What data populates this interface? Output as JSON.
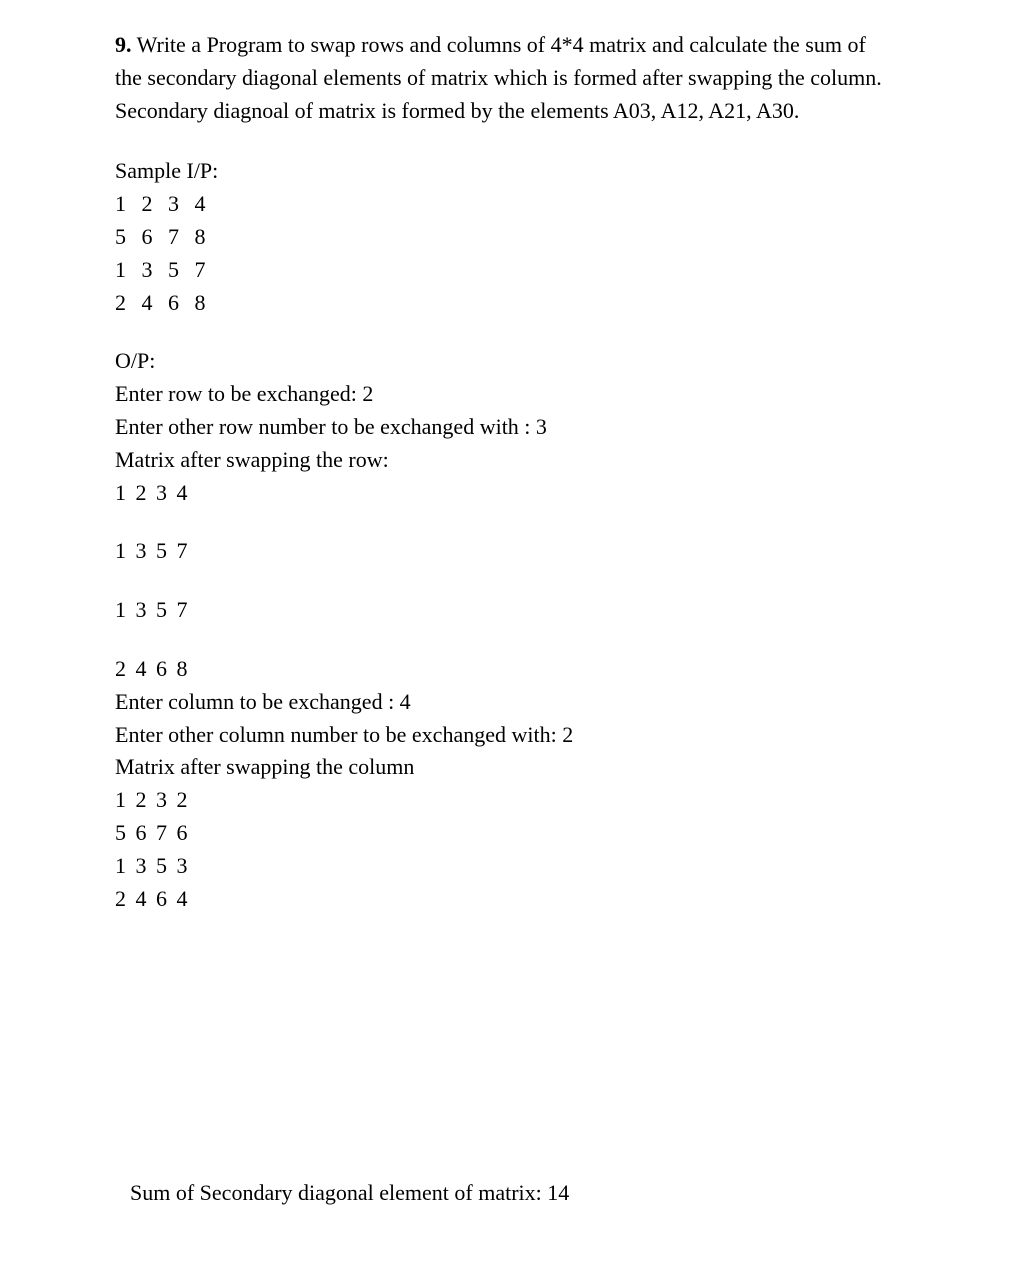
{
  "question": {
    "number": "9.",
    "text1": "Write a  Program to swap rows and columns of 4*4 matrix and calculate the sum of",
    "text2": "the secondary diagonal elements of matrix which is formed after swapping the  column.",
    "text3": "Secondary diagnoal of matrix is formed by the elements A03, A12, A21, A30."
  },
  "sample_ip": {
    "label": "Sample I/P:",
    "rows": [
      "1   2   3   4",
      "5   6   7   8",
      "1   3   5   7",
      "2   4   6   8"
    ]
  },
  "op": {
    "label": "O/P:",
    "row_prompt1": "Enter row to be exchanged: 2",
    "row_prompt2": "Enter other row number to be exchanged with : 3",
    "after_row_label": "Matrix after swapping the row:",
    "row_matrix": [
      "1 2 3 4",
      "1 3 5 7",
      "1 3 5 7",
      "2 4 6 8"
    ],
    "col_prompt1": "Enter column to be exchanged : 4",
    "col_prompt2": "Enter other column number to be exchanged with: 2",
    "after_col_label": "Matrix after swapping the column",
    "col_matrix": [
      "1 2 3 2",
      "5 6 7 6",
      "1 3 5 3",
      "2 4 6 4"
    ]
  },
  "sum": "Sum of Secondary diagonal element of matrix: 14"
}
